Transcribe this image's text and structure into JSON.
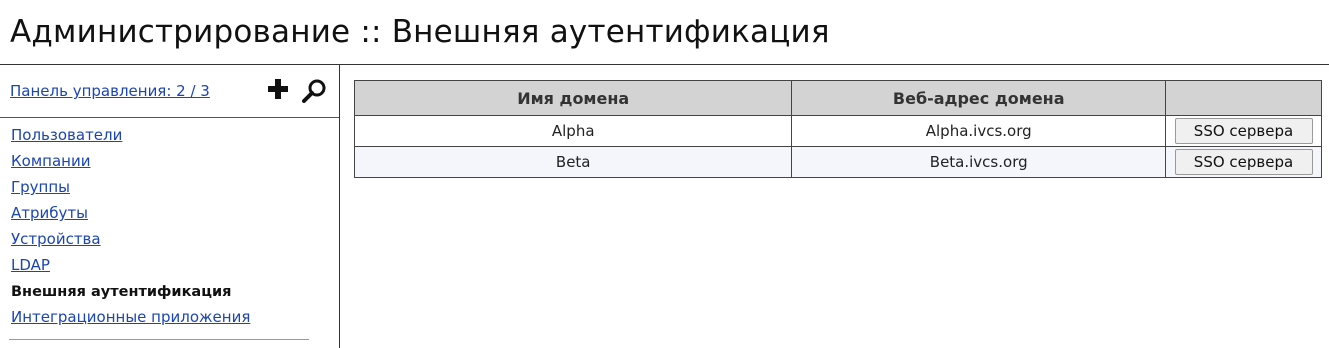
{
  "header": {
    "title": "Администрирование :: Внешняя аутентификация"
  },
  "sidebar": {
    "panel_link": "Панель управления: 2 / 3",
    "tools": [
      {
        "icon": "plus-icon"
      },
      {
        "icon": "search-icon"
      }
    ],
    "items": [
      {
        "label": "Пользователи",
        "active": false
      },
      {
        "label": "Компании",
        "active": false
      },
      {
        "label": "Группы",
        "active": false
      },
      {
        "label": "Атрибуты",
        "active": false
      },
      {
        "label": "Устройства",
        "active": false
      },
      {
        "label": "LDAP",
        "active": false
      },
      {
        "label": "Внешняя аутентификация",
        "active": true
      },
      {
        "label": "Интеграционные приложения",
        "active": false
      }
    ]
  },
  "table": {
    "columns": [
      "Имя домена",
      "Веб-адрес домена",
      ""
    ],
    "rows": [
      {
        "name": "Alpha",
        "url": "Alpha.ivcs.org",
        "action": "SSO сервера"
      },
      {
        "name": "Beta",
        "url": "Beta.ivcs.org",
        "action": "SSO сервера"
      }
    ]
  },
  "colors": {
    "link": "#1a44b8",
    "header_bg": "#d3d3d3",
    "alt_row_bg": "#f4f6fb"
  }
}
